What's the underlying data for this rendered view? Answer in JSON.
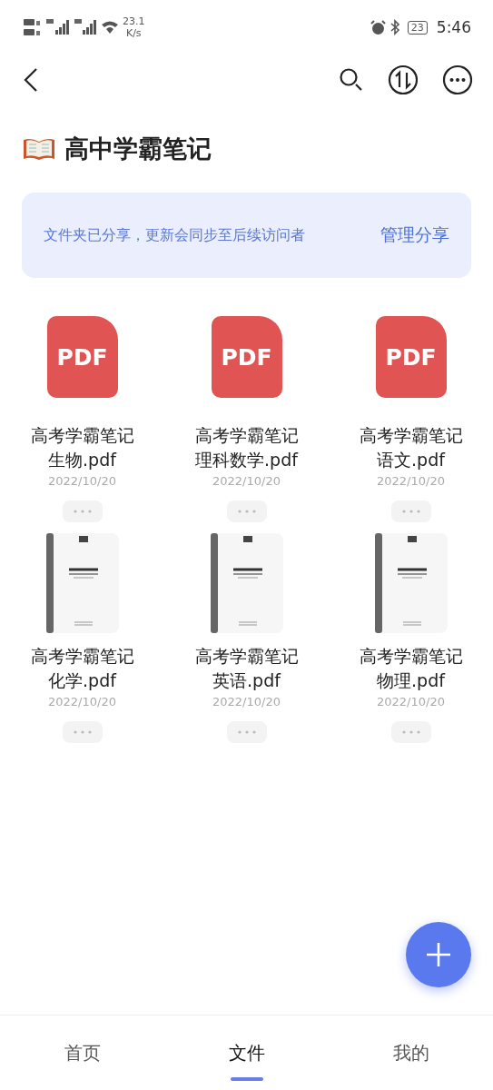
{
  "status_bar": {
    "network_speed": "23.1",
    "speed_unit": "K/s",
    "battery": "23",
    "time": "5:46"
  },
  "folder": {
    "title": "高中学霸笔记"
  },
  "share_banner": {
    "message": "文件夹已分享，更新会同步至后续访问者",
    "action": "管理分享"
  },
  "files": [
    {
      "kind": "pdf",
      "badge": "PDF",
      "name": "高考学霸笔记生物.pdf",
      "date": "2022/10/20"
    },
    {
      "kind": "pdf",
      "badge": "PDF",
      "name": "高考学霸笔记理科数学.pdf",
      "date": "2022/10/20"
    },
    {
      "kind": "pdf",
      "badge": "PDF",
      "name": "高考学霸笔记语文.pdf",
      "date": "2022/10/20"
    },
    {
      "kind": "cover",
      "name": "高考学霸笔记化学.pdf",
      "date": "2022/10/20"
    },
    {
      "kind": "cover",
      "name": "高考学霸笔记英语.pdf",
      "date": "2022/10/20"
    },
    {
      "kind": "cover",
      "name": "高考学霸笔记物理.pdf",
      "date": "2022/10/20"
    }
  ],
  "bottom_nav": [
    {
      "label": "首页",
      "selected": false
    },
    {
      "label": "文件",
      "selected": true
    },
    {
      "label": "我的",
      "selected": false
    }
  ]
}
